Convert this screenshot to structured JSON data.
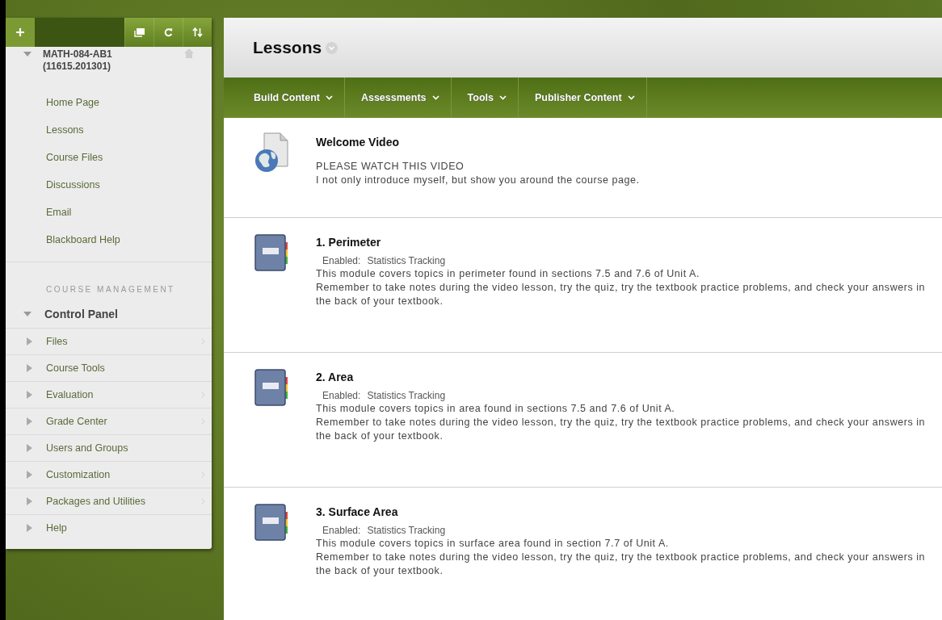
{
  "sidebar": {
    "course": {
      "code": "MATH-084-AB1",
      "id": "(11615.201301)",
      "expanded": true
    },
    "links": [
      "Home Page",
      "Lessons",
      "Course Files",
      "Discussions",
      "Email",
      "Blackboard Help"
    ],
    "section_heading": "COURSE MANAGEMENT",
    "control_panel": {
      "label": "Control Panel",
      "expanded": true,
      "items": [
        {
          "label": "Files",
          "submenu": true
        },
        {
          "label": "Course Tools",
          "submenu": false
        },
        {
          "label": "Evaluation",
          "submenu": true
        },
        {
          "label": "Grade Center",
          "submenu": true
        },
        {
          "label": "Users and Groups",
          "submenu": false
        },
        {
          "label": "Customization",
          "submenu": true
        },
        {
          "label": "Packages and Utilities",
          "submenu": true
        },
        {
          "label": "Help",
          "submenu": false
        }
      ]
    }
  },
  "page_title": "Lessons",
  "menu": [
    "Build Content",
    "Assessments",
    "Tools",
    "Publisher Content"
  ],
  "items": [
    {
      "kind": "video",
      "title": "Welcome Video",
      "lines": [
        "PLEASE WATCH THIS VIDEO",
        "I not only introduce myself, but show you around the course page."
      ]
    },
    {
      "kind": "module",
      "title": "1. Perimeter",
      "tracking_label": "Enabled:",
      "tracking_value": "Statistics Tracking",
      "lines": [
        "This module covers topics in perimeter found in sections 7.5 and 7.6 of Unit A.",
        "Remember to take notes during the video lesson, try the quiz, try the textbook practice problems, and check your answers in the back of your textbook."
      ]
    },
    {
      "kind": "module",
      "title": "2. Area",
      "tracking_label": "Enabled:",
      "tracking_value": "Statistics Tracking",
      "lines": [
        "This module covers topics in area found in sections 7.5 and 7.6 of Unit A.",
        "Remember to take notes during the video lesson, try the quiz, try the textbook practice problems, and check your answers in the back of your textbook."
      ]
    },
    {
      "kind": "module",
      "title": "3. Surface Area",
      "tracking_label": "Enabled:",
      "tracking_value": "Statistics Tracking",
      "lines": [
        "This module covers topics in surface area found in section 7.7 of Unit A.",
        "Remember to take notes during the video lesson, try the quiz, try the textbook practice problems, and check your answers in the back of your textbook."
      ]
    }
  ]
}
